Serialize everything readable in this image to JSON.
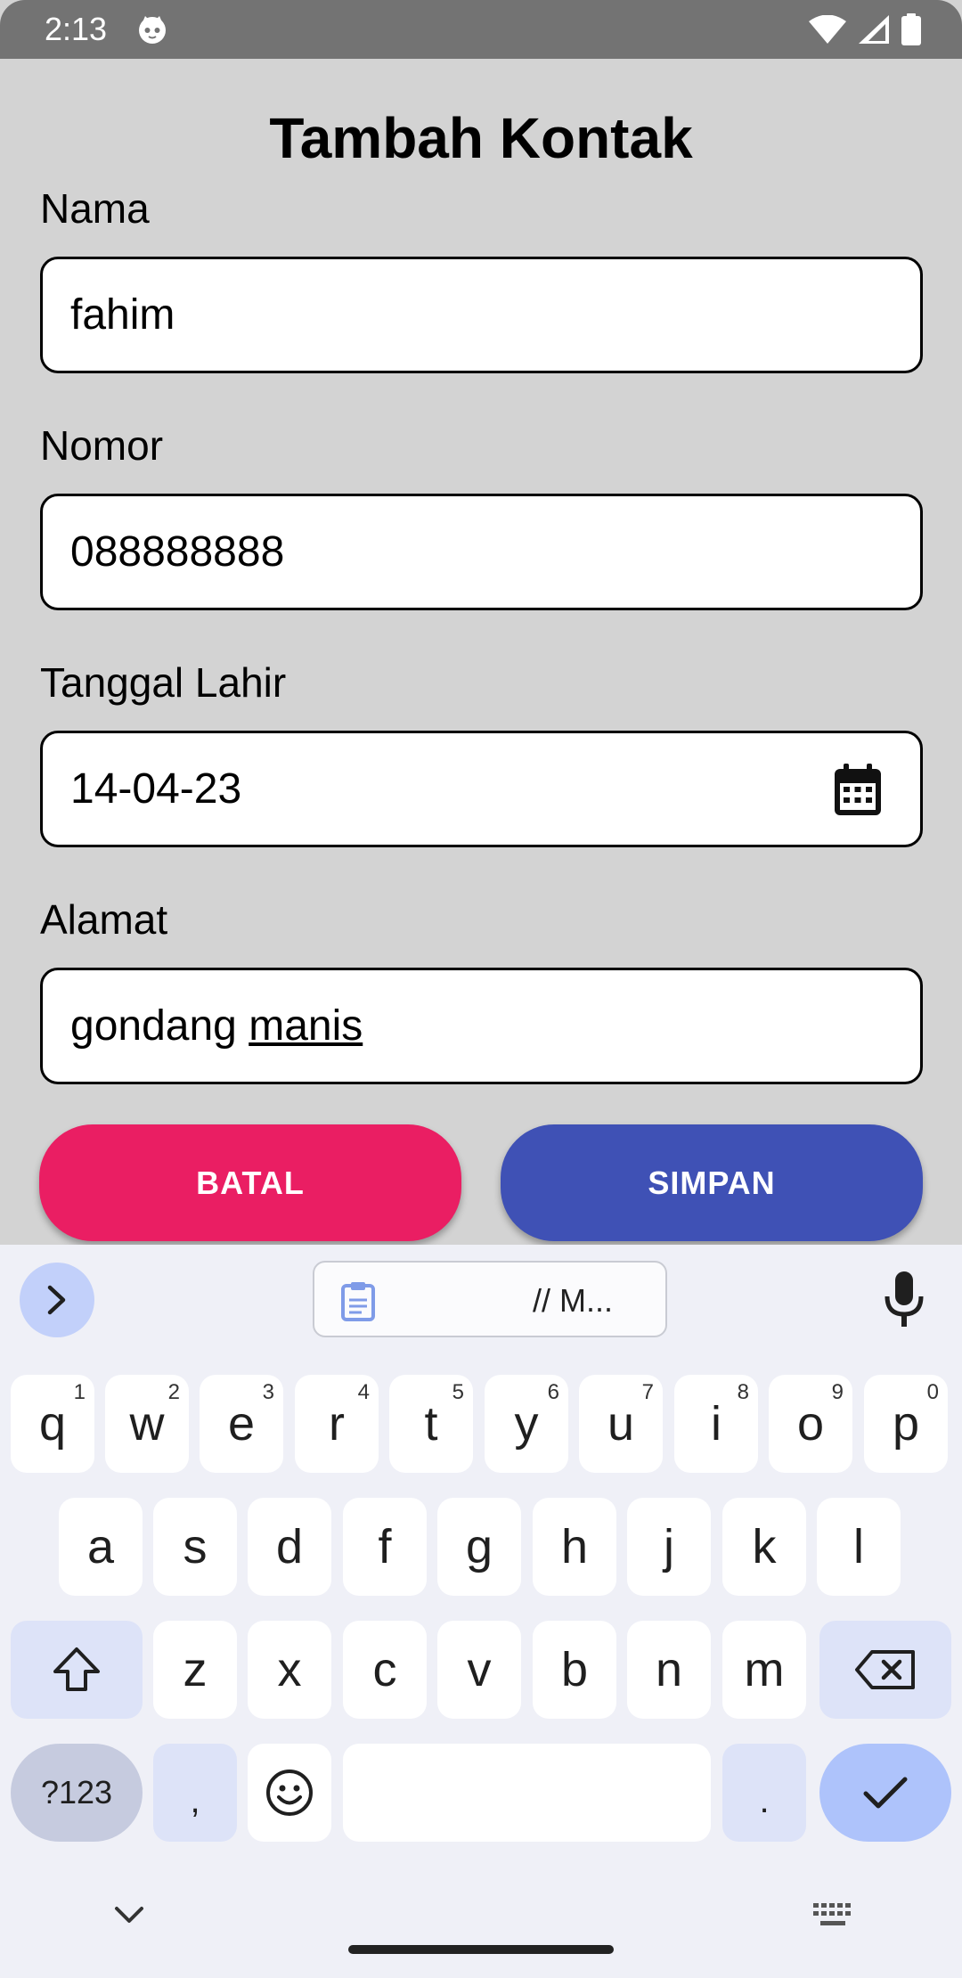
{
  "status_bar": {
    "time": "2:13",
    "icons": [
      "cat-notification-icon",
      "wifi-icon",
      "signal-icon",
      "battery-icon"
    ]
  },
  "form": {
    "title": "Tambah Kontak",
    "fields": [
      {
        "label": "Nama",
        "value": "fahim"
      },
      {
        "label": "Nomor",
        "value": "088888888"
      },
      {
        "label": "Tanggal Lahir",
        "value": "14-04-23",
        "icon": "calendar-icon"
      },
      {
        "label": "Alamat",
        "value_plain": "gondang ",
        "value_underlined": "manis"
      }
    ],
    "cancel_label": "BATAL",
    "save_label": "SIMPAN"
  },
  "colors": {
    "background": "#d3d3d3",
    "cancel_button": "#ea1e63",
    "save_button": "#3f51b5",
    "keyboard_bg": "#eff0f7",
    "keyboard_accent": "#c2d0fa"
  },
  "keyboard": {
    "clipboard_text": "// M...",
    "row1": [
      {
        "key": "q",
        "hint": "1"
      },
      {
        "key": "w",
        "hint": "2"
      },
      {
        "key": "e",
        "hint": "3"
      },
      {
        "key": "r",
        "hint": "4"
      },
      {
        "key": "t",
        "hint": "5"
      },
      {
        "key": "y",
        "hint": "6"
      },
      {
        "key": "u",
        "hint": "7"
      },
      {
        "key": "i",
        "hint": "8"
      },
      {
        "key": "o",
        "hint": "9"
      },
      {
        "key": "p",
        "hint": "0"
      }
    ],
    "row2": [
      "a",
      "s",
      "d",
      "f",
      "g",
      "h",
      "j",
      "k",
      "l"
    ],
    "row3": [
      "z",
      "x",
      "c",
      "v",
      "b",
      "n",
      "m"
    ],
    "symbols_label": "?123",
    "comma": ",",
    "period": "."
  }
}
